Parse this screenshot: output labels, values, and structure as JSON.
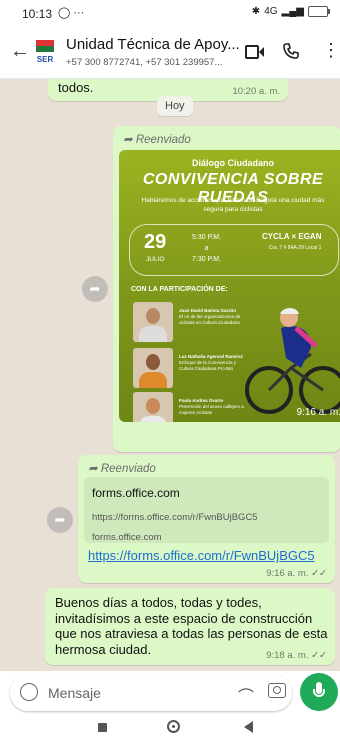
{
  "status_bar": {
    "time": "10:13",
    "signal_text": "4G"
  },
  "header": {
    "title": "Unidad Técnica de Apoy...",
    "subtitle": "+57 300 8772741, +57 301 239957..."
  },
  "chat": {
    "prev_message": {
      "text": "todos.",
      "time": "10:20 a. m."
    },
    "day_divider": "Hoy",
    "poster_message": {
      "forwarded_label": "Reenviado",
      "time": "9:16 a. m.",
      "poster": {
        "header": "Diálogo Ciudadano",
        "title": "CONVIVENCIA SOBRE RUEDAS",
        "subtitle": "Hablaremos de acciones que hacen de Bogotá una ciudad más segura para ciclistas",
        "day": "29",
        "month": "JULIO",
        "time_start": "5:30 P.M.",
        "time_sep": "a",
        "time_end": "7:30 P.M.",
        "place": "CYCLA × EGAN",
        "address": "Cra. 7 # 84A-29 Local 1",
        "participation_label": "CON LA PARTICIPACIÓN DE:",
        "participants": [
          {
            "name": "Juan David Batista Garzón",
            "role": "El rol de las organizaciones de ciclistas en Cultura Ciudadana"
          },
          {
            "name": "Luz Nathalia Agencel Ramírez",
            "role": "Enfoque de la Convivencia y Cultura Ciudadana Pro Bici"
          },
          {
            "name": "Paola Andrea Ovarte",
            "role": "Prevención del acoso callejero a mujeres ciclistas"
          }
        ]
      }
    },
    "link_message": {
      "forwarded_label": "Reenviado",
      "preview_title": "forms.office.com",
      "preview_description": "https://forms.office.com/r/FwnBUjBGC5",
      "preview_host": "forms.office.com",
      "url": "https://forms.office.com/r/FwnBUjBGC5",
      "time": "9:16 a. m."
    },
    "text_message": {
      "text": "Buenos días a todos, todas y todes, invitadísimos a este espacio de construcción que nos atraviesa a todas las personas de esta hermosa ciudad.",
      "time": "9:18 a. m."
    }
  },
  "composer": {
    "placeholder": "Mensaje"
  },
  "colors": {
    "outgoing_bubble": "#dcf8c6",
    "wallpaper": "#e8e0d5",
    "mic_button": "#1faa59",
    "link": "#1a6fd1",
    "poster_green": "#8aa31c"
  }
}
